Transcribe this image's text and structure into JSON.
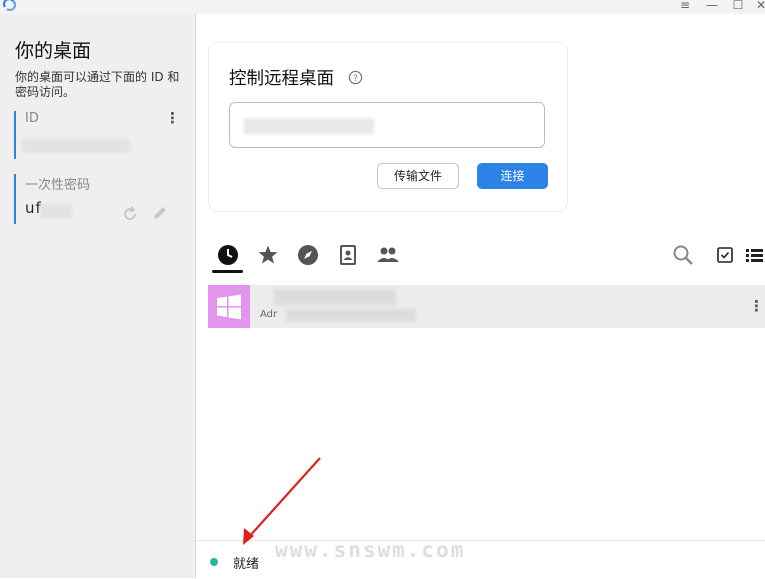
{
  "sidebar": {
    "title": "你的桌面",
    "description": "你的桌面可以通过下面的 ID 和密码访问。",
    "id_label": "ID",
    "id_value": "",
    "password_label": "一次性密码",
    "password_value": "uf"
  },
  "connect_card": {
    "title": "控制远程桌面",
    "remote_id_value": "",
    "transfer_button": "传输文件",
    "connect_button": "连接"
  },
  "tabs": [
    "recent-sessions",
    "favorites",
    "discovered",
    "address-book",
    "group"
  ],
  "peers": [
    {
      "name": "",
      "subtitle": "Adr"
    }
  ],
  "status": {
    "text": "就绪",
    "color": "#2bb5a1"
  },
  "watermark": "www.snswm.com",
  "colors": {
    "accent": "#2d82e6",
    "peer_thumb": "#e195ec",
    "arrow": "#e02020"
  }
}
